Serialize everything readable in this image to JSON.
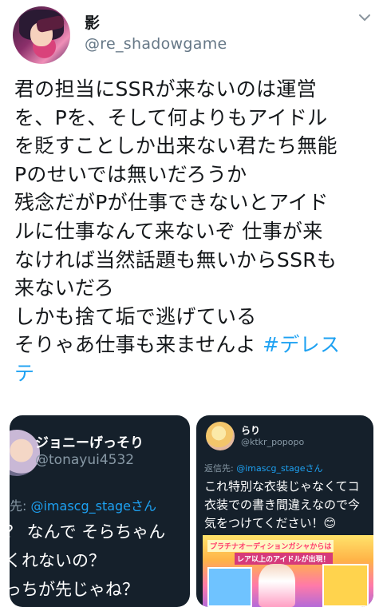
{
  "author": {
    "name": "影",
    "handle": "@re_shadowgame"
  },
  "tweet": {
    "lines": [
      "君の担当にSSRが来ないのは運営",
      "を、Pを、そして何よりもアイドル",
      "を貶すことしか出来ない君たち無能",
      "Pのせいでは無いだろうか",
      "残念だがPが仕事できないとアイド",
      "ルに仕事なんて来ないぞ 仕事が来",
      "なければ当然話題も無いからSSRも",
      "来ないだろ",
      "しかも捨て垢で逃げている"
    ],
    "line10_text": "そりゃあ仕事も来ませんよ ",
    "hashtag_part1": "#デレス",
    "hashtag_part2": "テ"
  },
  "embed_left": {
    "name": "ジョニーげっそり",
    "handle": "@tonayui4532",
    "reply_prefix": "先: ",
    "reply_mention": "@imascg_stageさん",
    "body_lines": [
      "？ なんで そらちゃん",
      "くれないの？",
      "っちが先じゃね？"
    ]
  },
  "embed_right": {
    "name": "らり",
    "handle": "@ktkr_popopo",
    "reply_prefix": "返信先: ",
    "reply_mention": "@imascg_stageさん",
    "body_lines": [
      "これ特別な衣装じゃなくてコ",
      "衣装での書き間違えなので今",
      "気をつけてください！😊"
    ],
    "banner_lines": [
      "プラチナオーディションガシャからは",
      "レア以上のアイドルが出現！"
    ]
  },
  "colors": {
    "hashtag": "#1da1f2",
    "embed_bg": "#15202b",
    "secondary_text": "#657786"
  },
  "icons": [
    "avatar",
    "chevron-down-icon",
    "embed-avatar-left",
    "embed-avatar-right"
  ]
}
